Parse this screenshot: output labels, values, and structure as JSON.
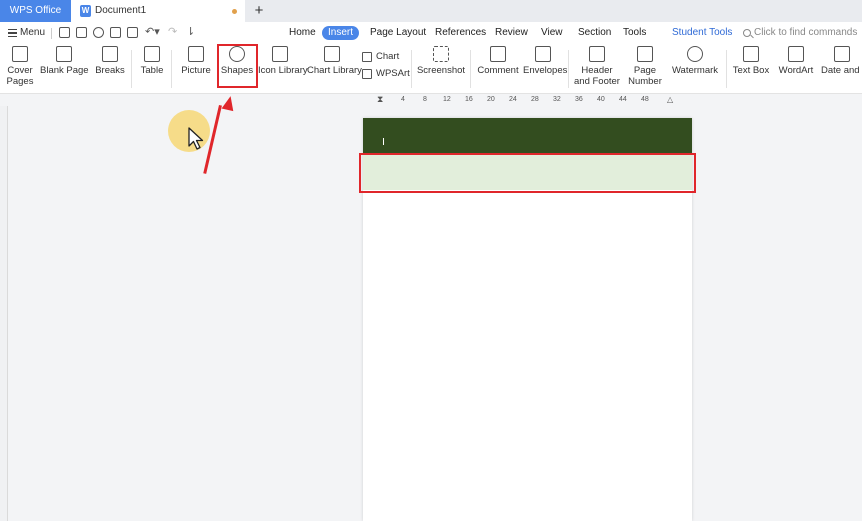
{
  "titlebar": {
    "app_tab": "WPS Office",
    "doc_tab": "Document1",
    "new_tab": "+"
  },
  "menubar": {
    "menu_label": "Menu",
    "tabs": [
      "Home",
      "Insert",
      "Page Layout",
      "References",
      "Review",
      "View",
      "Section",
      "Tools",
      "Student Tools"
    ],
    "active_tab": "Insert",
    "search_placeholder": "Click to find commands"
  },
  "ribbon": {
    "cover_pages": "Cover Pages",
    "blank_page": "Blank Page",
    "breaks": "Breaks",
    "table": "Table",
    "picture": "Picture",
    "shapes": "Shapes",
    "icon_library": "Icon Library",
    "chart_library": "Chart Library",
    "chart": "Chart",
    "wpsart": "WPSArt",
    "screenshot": "Screenshot",
    "comment": "Comment",
    "envelopes": "Envelopes",
    "header_footer": "Header and Footer",
    "page_number": "Page Number",
    "watermark": "Watermark",
    "text_box": "Text Box",
    "wordart": "WordArt",
    "date_time": "Date and Ti"
  },
  "ruler": {
    "ticks": [
      "4",
      "8",
      "12",
      "16",
      "20",
      "24",
      "28",
      "32",
      "36",
      "40",
      "44",
      "48"
    ]
  },
  "colors": {
    "accent": "#4a86e8",
    "highlight": "#e0262b",
    "header_band": "#334d1f",
    "green_band": "#e2eedb"
  }
}
